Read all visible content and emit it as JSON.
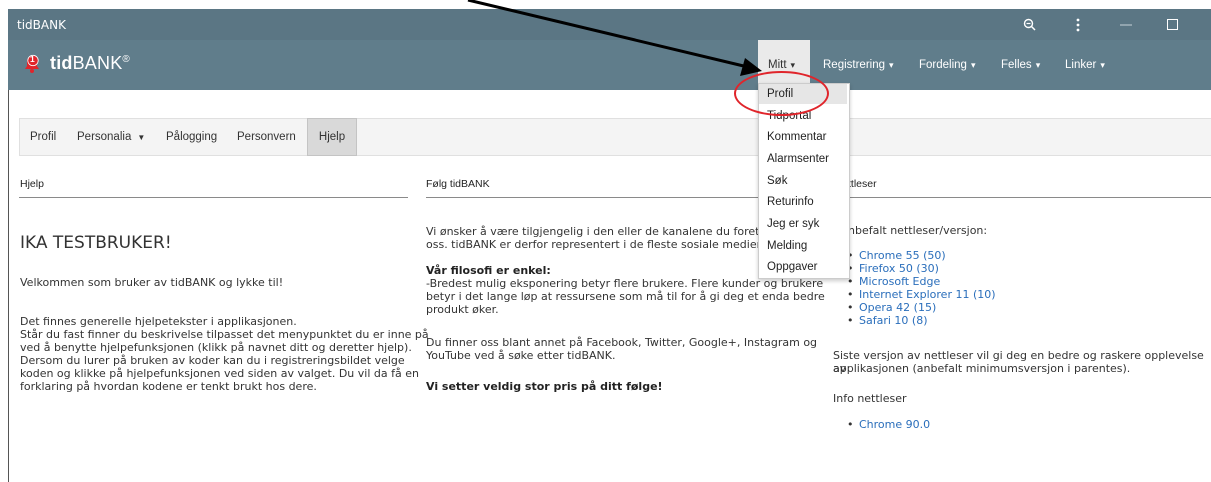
{
  "window": {
    "title": "tidBANK"
  },
  "navbar": {
    "notification_count": "1",
    "logo_prefix": "tid",
    "logo_suffix": "BANK",
    "logo_mark": "®",
    "menus": [
      {
        "label": "Mitt"
      },
      {
        "label": "Registrering"
      },
      {
        "label": "Fordeling"
      },
      {
        "label": "Felles"
      },
      {
        "label": "Linker"
      }
    ]
  },
  "dropdown": {
    "items": [
      "Profil",
      "Tidportal",
      "Kommentar",
      "Alarmsenter",
      "Søk",
      "Returinfo",
      "Jeg er syk",
      "Melding",
      "Oppgaver"
    ]
  },
  "tabs": [
    "Profil",
    "Personalia",
    "Pålogging",
    "Personvern",
    "Hjelp"
  ],
  "columns": {
    "left": {
      "header": "Hjelp",
      "heading": "IKA TESTBRUKER!",
      "welcome": "Velkommen som bruker av tidBANK og lykke til!",
      "body_lines": [
        "Det finnes generelle hjelpetekster i applikasjonen.",
        "Står du fast finner du beskrivelse tilpasset det menypunktet du er inne på",
        "ved å benytte hjelpefunksjonen (klikk på navnet ditt og deretter hjelp).",
        "Dersom du lurer på bruken av koder kan du i registreringsbildet velge",
        "koden og klikke på hjelpefunksjonen ved siden av valget. Du vil da få en",
        "forklaring på hvordan kodene er tenkt brukt hos dere."
      ]
    },
    "middle": {
      "header": "Følg tidBANK",
      "intro_lines": [
        "Vi ønsker å være tilgjengelig i den eller de kanalene du foretrekker",
        "oss. tidBANK er derfor representert i de fleste sosiale medier."
      ],
      "philosophy_title": "Vår filosofi er enkel:",
      "philosophy_lines": [
        "-Bredest mulig eksponering betyr flere brukere. Flere kunder og brukere",
        "betyr i det lange løp at ressursene som må til for å gi deg et enda bedre",
        "produkt øker."
      ],
      "social_lines": [
        "Du finner oss blant annet på Facebook, Twitter, Google+, Instagram og",
        "YouTube ved å søke etter tidBANK."
      ],
      "closing": "Vi setter veldig stor pris på ditt følge!"
    },
    "right": {
      "header": "ttleser",
      "recommended_label": "nbefalt nettleser/versjon:",
      "browsers": [
        "Chrome 55 (50)",
        "Firefox 50 (30)",
        "Microsoft Edge",
        "Internet Explorer 11 (10)",
        "Opera 42 (15)",
        "Safari 10 (8)"
      ],
      "note_lines": [
        "Siste versjon av nettleser vil gi deg en bedre og raskere opplevelse av",
        "applikasjonen (anbefalt minimumsversjon i parentes)."
      ],
      "info_label": "Info nettleser",
      "current_browser": "Chrome 90.0"
    }
  },
  "colors": {
    "titlebar": "#5b7684",
    "navbar": "#607d8b",
    "accent_red": "#e0252b",
    "link": "#2a6ebb"
  }
}
